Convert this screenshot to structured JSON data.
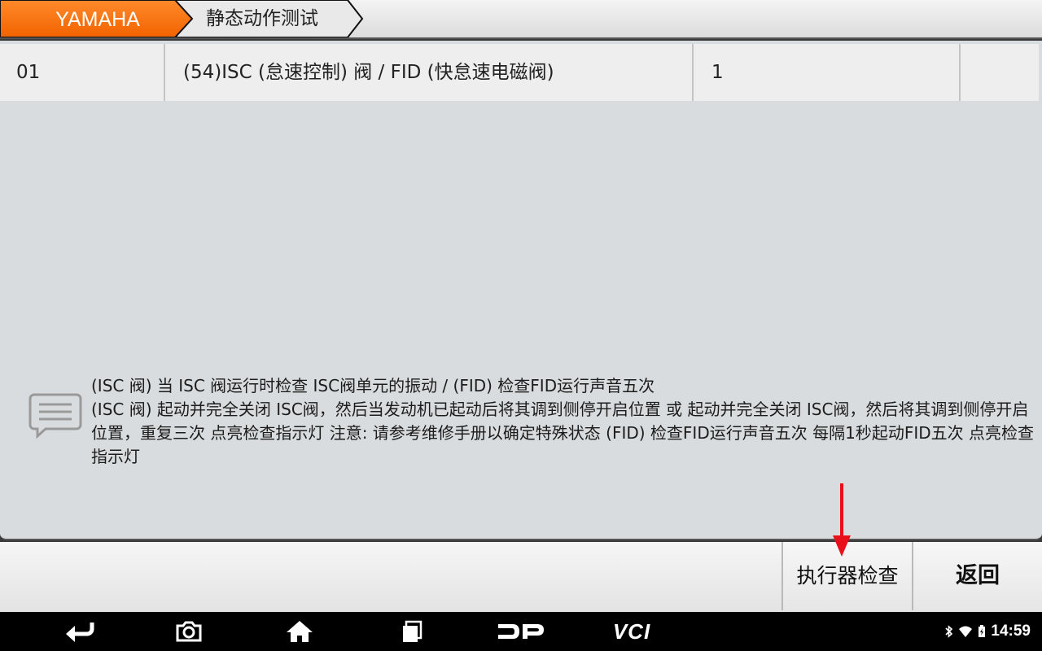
{
  "header": {
    "brand": "YAMAHA",
    "page_title": "静态动作测试",
    "brand_color": "#ff6a00"
  },
  "table": {
    "rows": [
      {
        "id": "01",
        "name": "(54)ISC (怠速控制) 阀 / FID (快怠速电磁阀)",
        "value": "1",
        "extra": ""
      }
    ]
  },
  "message": {
    "icon": "message-icon",
    "lines": [
      "(ISC 阀) 当 ISC 阀运行时检查 ISC阀单元的振动 / (FID) 检查FID运行声音五次",
      "(ISC 阀) 起动并完全关闭 ISC阀，然后当发动机已起动后将其调到侧停开启位置 或 起动并完全关闭 ISC阀，然后将其调到侧停开启位置，重复三次 点亮检查指示灯 注意: 请参考维修手册以确定特殊状态 (FID) 检查FID运行声音五次 每隔1秒起动FID五次 点亮检查指示灯"
    ]
  },
  "toolbar": {
    "actuator_label": "执行器检查",
    "back_label": "返回"
  },
  "navbar": {
    "items": [
      "back-icon",
      "camera-icon",
      "home-icon",
      "recent-apps-icon",
      "dp-logo-icon",
      "vci-logo-icon"
    ],
    "vci_text": "VCI",
    "time": "14:59"
  }
}
